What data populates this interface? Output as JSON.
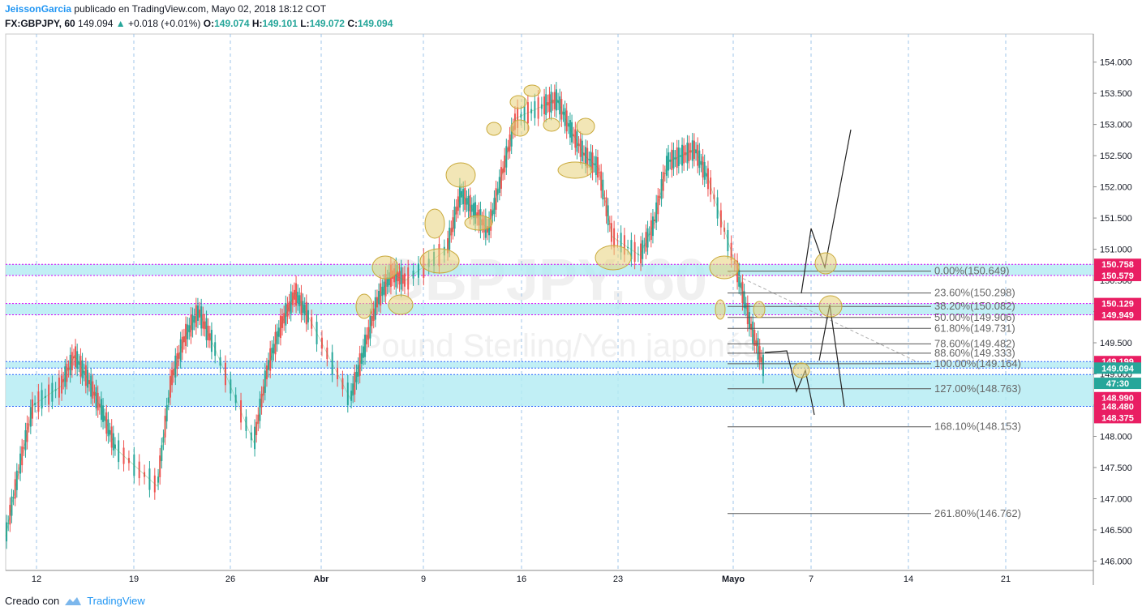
{
  "header": {
    "author": "JeissonGarcia",
    "published": "publicado en TradingView.com, Mayo 02, 2018 18:12 COT",
    "symbol": "FX:GBPJPY, 60",
    "last": "149.094",
    "change": "+0.018 (+0.01%)",
    "o_label": "O:",
    "o": "149.074",
    "h_label": "H:",
    "h": "149.101",
    "l_label": "L:",
    "l": "149.072",
    "c_label": "C:",
    "c": "149.094"
  },
  "watermark": {
    "symbol": "GBPJPY, 60",
    "name": "Pound Sterling/Yen japonés"
  },
  "footer": {
    "created": "Creado con",
    "brand": "TradingView"
  },
  "colors": {
    "up": "#26a69a",
    "down": "#ef5350",
    "zone": "#b2ebf2",
    "zone_line": "#d500f9",
    "blue_zone_line": "#2962ff",
    "ellipse": "#e8d27a",
    "grid": "#9fc5e8"
  },
  "chart_data": {
    "type": "line",
    "title": "",
    "xlabel": "",
    "ylabel": "",
    "ylim": [
      145.85,
      154.45
    ],
    "x_ticks": [
      "12",
      "19",
      "26",
      "Abr",
      "9",
      "16",
      "23",
      "Mayo",
      "7",
      "14",
      "21"
    ],
    "y_ticks": [
      "146.000",
      "146.500",
      "147.000",
      "147.500",
      "148.000",
      "148.500",
      "149.000",
      "149.500",
      "150.000",
      "150.500",
      "151.000",
      "151.500",
      "152.000",
      "152.500",
      "153.000",
      "153.500",
      "154.000"
    ],
    "series": [
      {
        "x": [
          "2018-03-08",
          "2018-03-09",
          "2018-03-10",
          "2018-03-12",
          "2018-03-13",
          "2018-03-14",
          "2018-03-15",
          "2018-03-16",
          "2018-03-19",
          "2018-03-20",
          "2018-03-21",
          "2018-03-22",
          "2018-03-23",
          "2018-03-26",
          "2018-03-27",
          "2018-03-28",
          "2018-03-29",
          "2018-03-30",
          "2018-04-02",
          "2018-04-03",
          "2018-04-04",
          "2018-04-05",
          "2018-04-06",
          "2018-04-09",
          "2018-04-10",
          "2018-04-11",
          "2018-04-12",
          "2018-04-13",
          "2018-04-14",
          "2018-04-16",
          "2018-04-17",
          "2018-04-18",
          "2018-04-19",
          "2018-04-20",
          "2018-04-21",
          "2018-04-23",
          "2018-04-24",
          "2018-04-25",
          "2018-04-26",
          "2018-04-27",
          "2018-04-28",
          "2018-04-30",
          "2018-05-01",
          "2018-05-02"
        ],
        "values": [
          146.4,
          147.5,
          148.5,
          148.8,
          149.3,
          148.9,
          148.4,
          147.8,
          147.2,
          148.9,
          149.6,
          150.0,
          149.5,
          147.9,
          149.1,
          149.8,
          150.3,
          149.9,
          148.6,
          149.4,
          150.2,
          150.6,
          150.5,
          151.0,
          151.9,
          151.6,
          151.3,
          152.2,
          153.1,
          153.3,
          153.4,
          152.9,
          152.5,
          152.3,
          151.2,
          150.9,
          151.4,
          152.4,
          152.5,
          152.6,
          152.1,
          150.7,
          149.8,
          149.094
        ]
      }
    ],
    "horizontal_zones": [
      {
        "top": "150.758",
        "bottom": "150.579"
      },
      {
        "top": "150.129",
        "bottom": "149.949"
      },
      {
        "top": "149.199",
        "bottom": "149.094"
      },
      {
        "top": "148.990",
        "bottom": "148.480"
      },
      {
        "top": "148.375",
        "bottom": "148.375"
      }
    ],
    "price_labels": [
      {
        "text": "150.758",
        "value": 150.758,
        "color": "#e91e63"
      },
      {
        "text": "150.579",
        "value": 150.579,
        "color": "#e91e63"
      },
      {
        "text": "150.129",
        "value": 150.129,
        "color": "#e91e63"
      },
      {
        "text": "149.949",
        "value": 149.949,
        "color": "#e91e63"
      },
      {
        "text": "149.199",
        "value": 149.199,
        "color": "#e91e63"
      },
      {
        "text": "149.094",
        "value": 149.094,
        "color": "#26a69a"
      },
      {
        "text": "47:30",
        "value": 148.85,
        "color": "#26a69a"
      },
      {
        "text": "148.990",
        "value": 148.62,
        "color": "#e91e63"
      },
      {
        "text": "148.480",
        "value": 148.48,
        "color": "#e91e63"
      },
      {
        "text": "148.375",
        "value": 148.3,
        "color": "#e91e63"
      }
    ],
    "fib_levels": [
      {
        "label": "0.00%(150.649)",
        "value": 150.649
      },
      {
        "label": "23.60%(150.298)",
        "value": 150.298
      },
      {
        "label": "38.20%(150.082)",
        "value": 150.082
      },
      {
        "label": "50.00%(149.906)",
        "value": 149.906
      },
      {
        "label": "61.80%(149.731)",
        "value": 149.731
      },
      {
        "label": "78.60%(149.482)",
        "value": 149.482
      },
      {
        "label": "88.60%(149.333)",
        "value": 149.333
      },
      {
        "label": "100.00%(149.164)",
        "value": 149.164
      },
      {
        "label": "127.00%(148.763)",
        "value": 148.763
      },
      {
        "label": "168.10%(148.153)",
        "value": 148.153
      },
      {
        "label": "261.80%(146.762)",
        "value": 146.762
      }
    ],
    "grid": true,
    "legend": "none"
  }
}
